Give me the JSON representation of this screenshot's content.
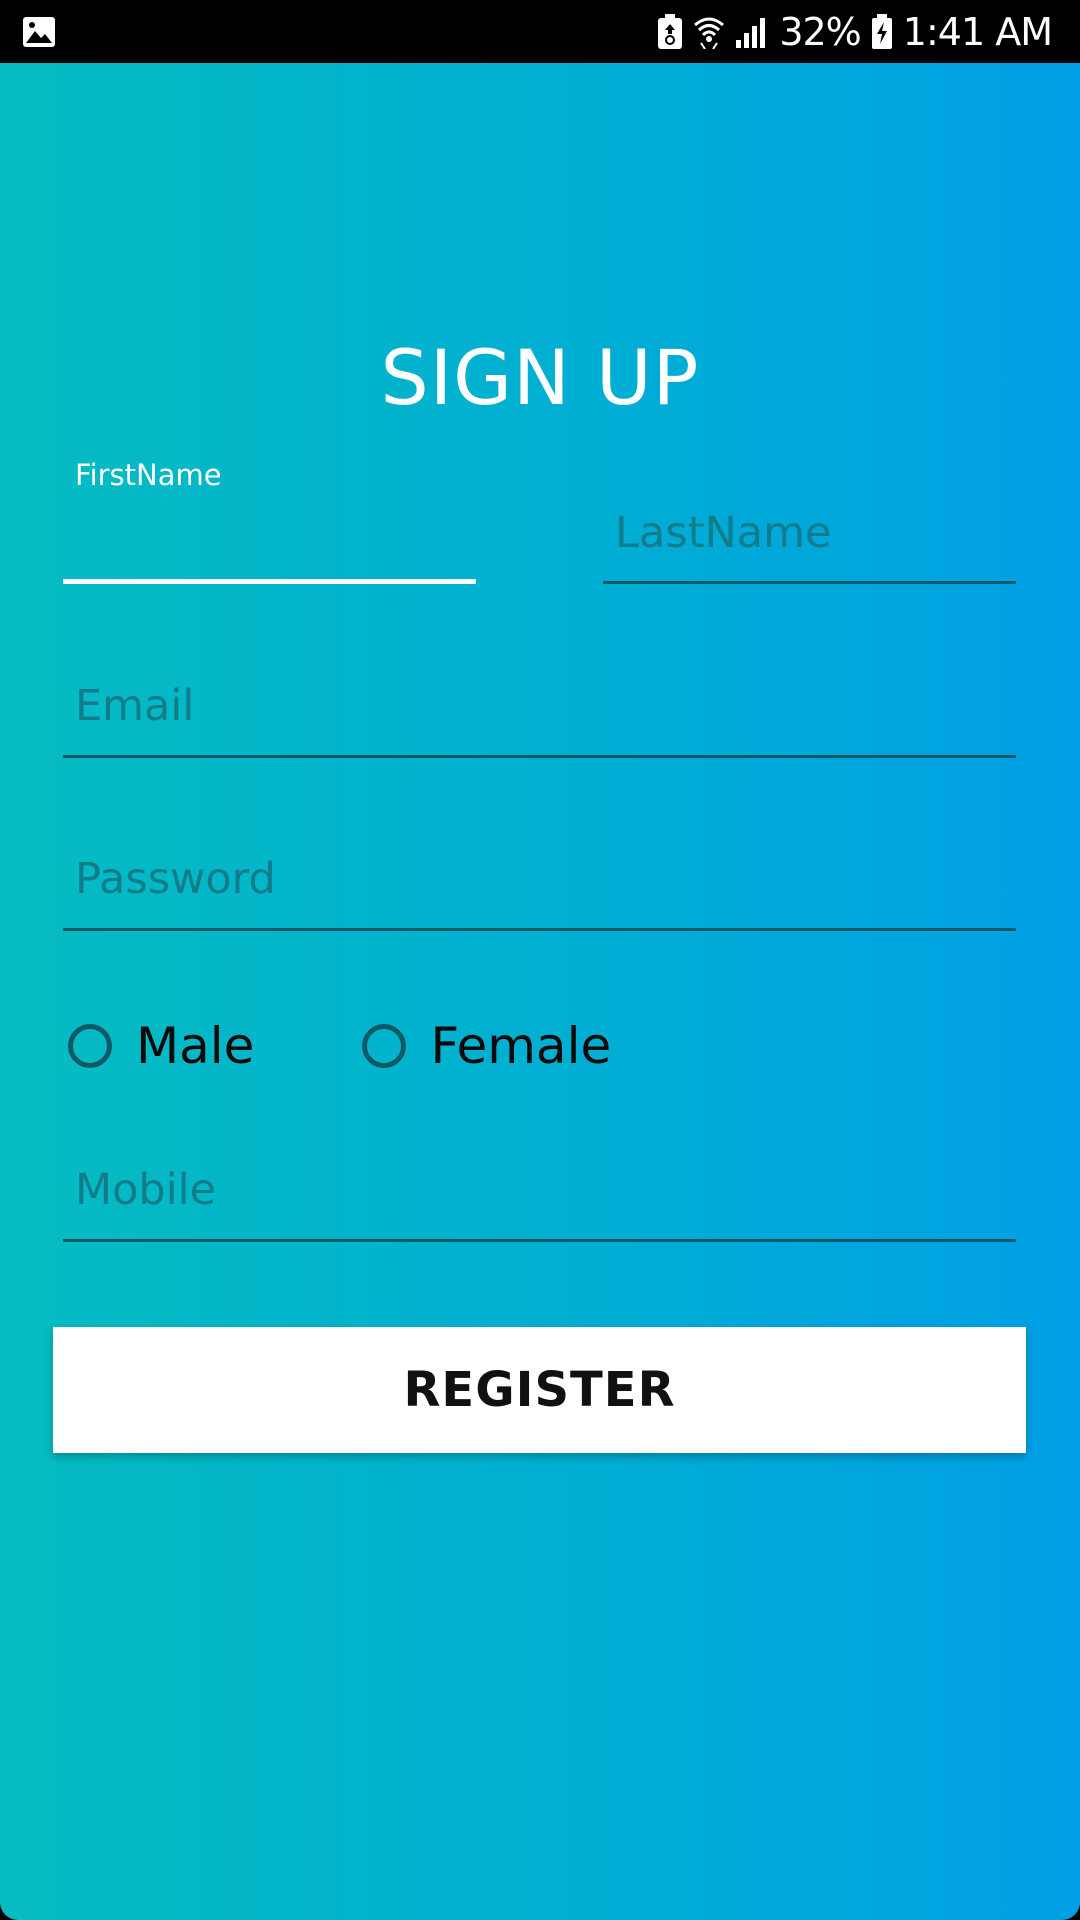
{
  "status_bar": {
    "battery_percent": "32%",
    "time": "1:41 AM",
    "icons": [
      "gallery-notification-icon",
      "battery-saver-icon",
      "wifi-icon",
      "cellular-signal-icon",
      "battery-charging-icon"
    ]
  },
  "form": {
    "title": "SIGN UP",
    "first_name": {
      "label": "FirstName",
      "value": ""
    },
    "last_name": {
      "placeholder": "LastName"
    },
    "email": {
      "placeholder": "Email"
    },
    "password": {
      "placeholder": "Password"
    },
    "gender": {
      "options": [
        {
          "label": "Male",
          "selected": false
        },
        {
          "label": "Female",
          "selected": false
        }
      ]
    },
    "mobile": {
      "placeholder": "Mobile"
    },
    "register_label": "REGISTER"
  },
  "colors": {
    "gradient_start": "#06bcc1",
    "gradient_end": "#009fe5",
    "underline": "#0f5a66",
    "active_underline": "#ffffff",
    "button_bg": "#ffffff"
  }
}
